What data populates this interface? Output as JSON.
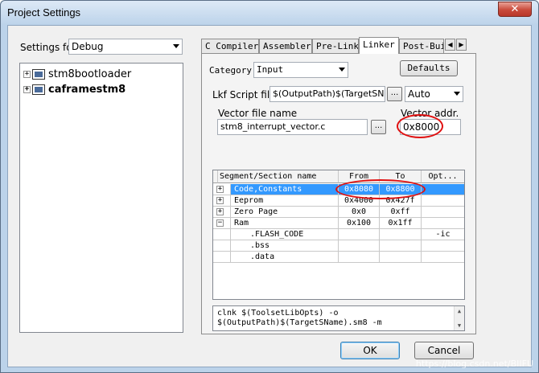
{
  "window": {
    "title": "Project Settings",
    "close_glyph": "✕"
  },
  "settings_for": {
    "label": "Settings for:",
    "value": "Debug"
  },
  "tree": {
    "items": [
      {
        "label": "stm8bootloader",
        "expander": "+"
      },
      {
        "label": "caframestm8",
        "expander": "+"
      }
    ]
  },
  "tabs": {
    "items": [
      "C Compiler",
      "Assembler",
      "Pre-Link",
      "Linker",
      "Post-Buil"
    ],
    "active": "Linker",
    "scroll_left": "◀",
    "scroll_right": "▶"
  },
  "linker": {
    "category_label": "Category",
    "category_value": "Input",
    "defaults_label": "Defaults",
    "lkf_label": "Lkf Script file:",
    "lkf_value": "$(OutputPath)$(TargetSName",
    "lkf_browse": "...",
    "lkf_mode": "Auto",
    "vector_file_label": "Vector file name",
    "vector_file_value": "stm8_interrupt_vector.c",
    "vector_browse": "...",
    "vector_addr_label": "Vector addr.",
    "vector_addr_value": "0x8000"
  },
  "segments": {
    "headers": [
      "Segment/Section name",
      "From",
      "To",
      "Opt..."
    ],
    "rows": [
      {
        "expander": "+",
        "name": "Code,Constants",
        "from": "0x8080",
        "to": "0x8800",
        "opt": "",
        "selected": true
      },
      {
        "expander": "+",
        "name": "Eeprom",
        "from": "0x4000",
        "to": "0x427f",
        "opt": ""
      },
      {
        "expander": "+",
        "name": "Zero Page",
        "from": "0x0",
        "to": "0xff",
        "opt": ""
      },
      {
        "expander": "−",
        "name": "Ram",
        "from": "0x100",
        "to": "0x1ff",
        "opt": ""
      },
      {
        "expander": "",
        "name": ".FLASH_CODE",
        "from": "",
        "to": "",
        "opt": "-ic"
      },
      {
        "expander": "",
        "name": ".bss",
        "from": "",
        "to": "",
        "opt": ""
      },
      {
        "expander": "",
        "name": ".data",
        "from": "",
        "to": "",
        "opt": ""
      }
    ]
  },
  "command": {
    "line1": "clnk $(ToolsetLibOpts) -o",
    "line2": "$(OutputPath)$(TargetSName).sm8 -m"
  },
  "buttons": {
    "ok": "OK",
    "cancel": "Cancel"
  },
  "watermark": "https://blog.csdn.net/BIIFU",
  "colors": {
    "selection": "#3399ff",
    "highlight_ellipse": "#e01010"
  }
}
